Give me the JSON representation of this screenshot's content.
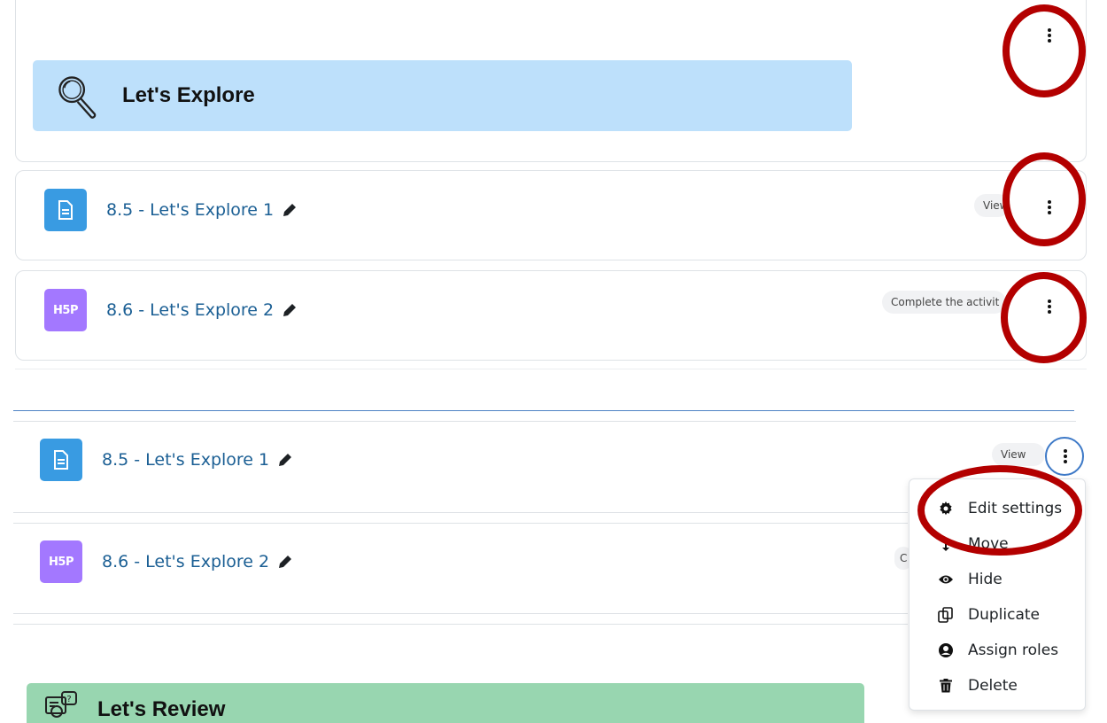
{
  "sections": {
    "explore": {
      "title": "Let's Explore",
      "icon": "magnifier-icon",
      "color": "#bde0fb"
    },
    "review": {
      "title": "Let's Review",
      "icon": "review-icon",
      "color": "#98d6b0"
    }
  },
  "activities": [
    {
      "name": "8.5 - Let's Explore 1",
      "type": "page",
      "badge": "View",
      "icon_text": ""
    },
    {
      "name": "8.6 - Let's Explore 2",
      "type": "h5p",
      "badge": "Complete the activit",
      "icon_text": "H5P"
    }
  ],
  "activities_dup": [
    {
      "name": "8.5 - Let's Explore 1",
      "badge": "View",
      "icon_text": ""
    },
    {
      "name": "8.6 - Let's Explore 2",
      "badge": "C",
      "icon_text": "H5P"
    }
  ],
  "menu": {
    "items": [
      {
        "label": "Edit settings",
        "icon": "gear-icon"
      },
      {
        "label": "Move",
        "icon": "move-icon"
      },
      {
        "label": "Hide",
        "icon": "eye-icon"
      },
      {
        "label": "Duplicate",
        "icon": "duplicate-icon"
      },
      {
        "label": "Assign roles",
        "icon": "user-icon"
      },
      {
        "label": "Delete",
        "icon": "trash-icon"
      }
    ]
  },
  "colors": {
    "highlight_ring": "#b30000",
    "link": "#1b5f94",
    "page_icon": "#399be2",
    "h5p_icon": "#a378ff"
  }
}
